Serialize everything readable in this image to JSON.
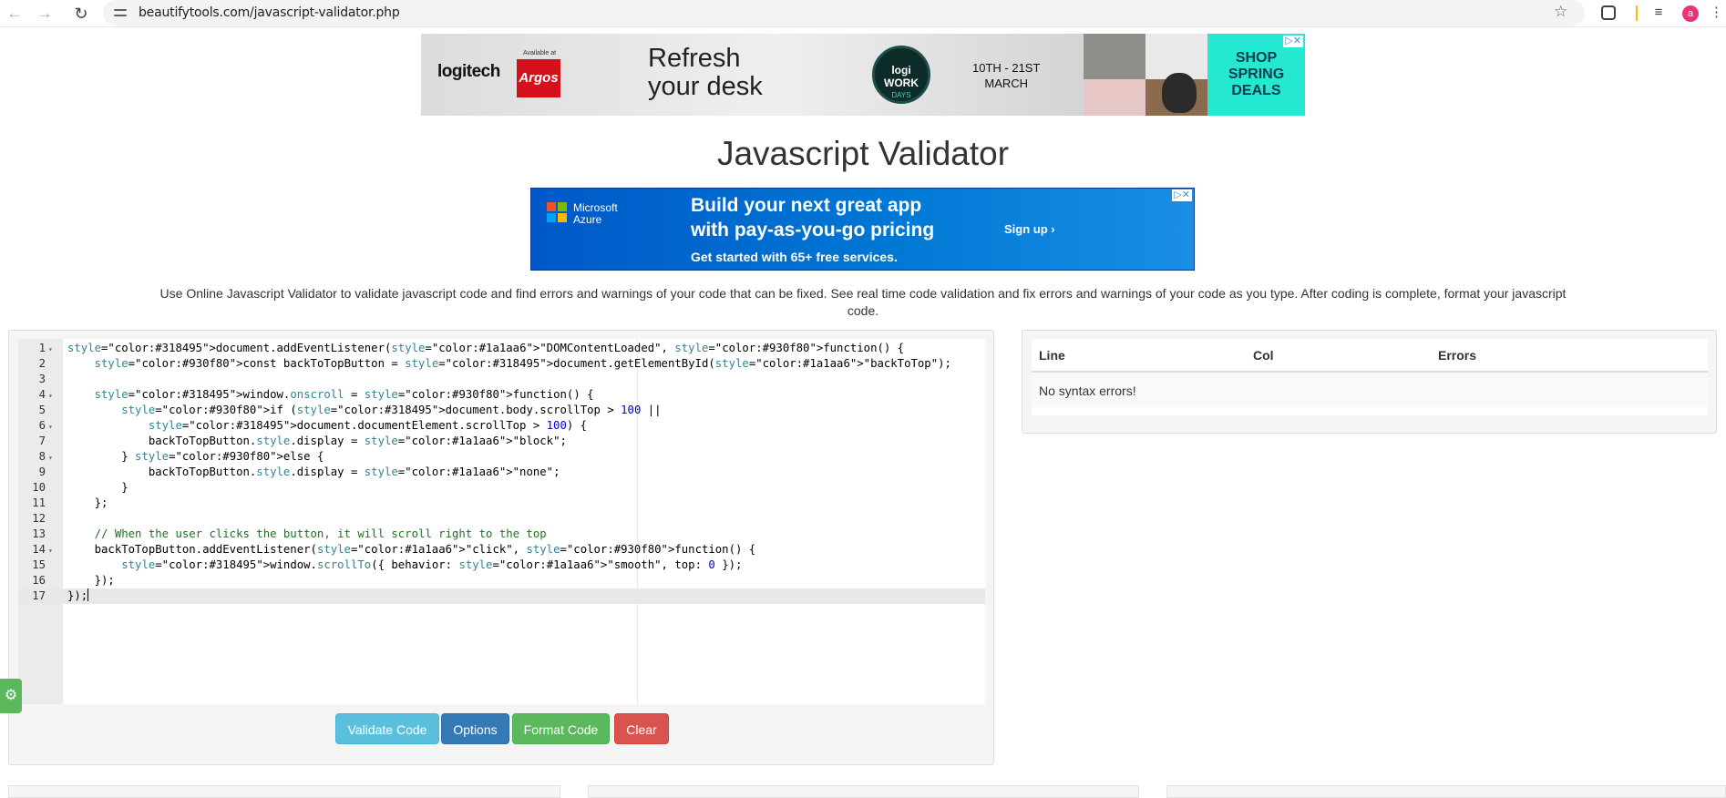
{
  "browser": {
    "url": "beautifytools.com/javascript-validator.php",
    "avatar_initial": "a",
    "icons": {
      "back": "arrow-left-icon",
      "forward": "arrow-right-icon",
      "reload": "reload-icon",
      "site_info": "tune-icon",
      "bookmark": "star-icon",
      "extensions": "puzzle-icon",
      "media": "playlist-icon",
      "menu": "kebab-menu-icon"
    }
  },
  "ad_top": {
    "brand": "logitech",
    "available_at": "Available at",
    "retailer": "Argos",
    "headline_line1": "Refresh",
    "headline_line2": "your desk",
    "badge_line1": "logi WORK",
    "badge_line2": "DAYS",
    "dates_line1": "10TH - 21ST",
    "dates_line2": "MARCH",
    "cta_line1": "SHOP",
    "cta_line2": "SPRING",
    "cta_line3": "DEALS",
    "close_glyph": "▷✕",
    "colors": {
      "argos": "#d4111b",
      "cta_bg": "#24e8d2"
    }
  },
  "page": {
    "title": "Javascript Validator",
    "intro": "Use Online Javascript Validator to validate javascript code and find errors and warnings of your code that can be fixed. See real time code validation and fix errors and warnings of your code as you type. After coding is complete, format your javascript code."
  },
  "ad_mid": {
    "brand_line1": "Microsoft",
    "brand_line2": "Azure",
    "headline_line1": "Build your next great app",
    "headline_line2": "with pay-as-you-go pricing",
    "cta": "Sign up ›",
    "subline": "Get started with 65+ free services.",
    "close_glyph": "▷✕",
    "colors": {
      "bg": "#0078d4"
    }
  },
  "editor": {
    "lines": [
      {
        "n": "1",
        "fold": "▾",
        "code": "document.addEventListener(\"DOMContentLoaded\", function() {"
      },
      {
        "n": "2",
        "fold": "",
        "code": "    const backToTopButton = document.getElementById(\"backToTop\");"
      },
      {
        "n": "3",
        "fold": "",
        "code": ""
      },
      {
        "n": "4",
        "fold": "▾",
        "code": "    window.onscroll = function() {"
      },
      {
        "n": "5",
        "fold": "",
        "code": "        if (document.body.scrollTop > 100 ||"
      },
      {
        "n": "6",
        "fold": "▾",
        "code": "            document.documentElement.scrollTop > 100) {"
      },
      {
        "n": "7",
        "fold": "",
        "code": "            backToTopButton.style.display = \"block\";"
      },
      {
        "n": "8",
        "fold": "▾",
        "code": "        } else {"
      },
      {
        "n": "9",
        "fold": "",
        "code": "            backToTopButton.style.display = \"none\";"
      },
      {
        "n": "10",
        "fold": "",
        "code": "        }"
      },
      {
        "n": "11",
        "fold": "",
        "code": "    };"
      },
      {
        "n": "12",
        "fold": "",
        "code": ""
      },
      {
        "n": "13",
        "fold": "",
        "code": "    // When the user clicks the button, it will scroll right to the top"
      },
      {
        "n": "14",
        "fold": "▾",
        "code": "    backToTopButton.addEventListener(\"click\", function() {"
      },
      {
        "n": "15",
        "fold": "",
        "code": "        window.scrollTo({ behavior: \"smooth\", top: 0 });"
      },
      {
        "n": "16",
        "fold": "",
        "code": "    });"
      },
      {
        "n": "17",
        "fold": "",
        "code": "});"
      }
    ],
    "active_line": "17"
  },
  "buttons": {
    "validate": "Validate Code",
    "options": "Options",
    "format": "Format Code",
    "clear": "Clear"
  },
  "results": {
    "col_line": "Line",
    "col_col": "Col",
    "col_errors": "Errors",
    "message": "No syntax errors!"
  },
  "settings_icon": "gear-icon"
}
